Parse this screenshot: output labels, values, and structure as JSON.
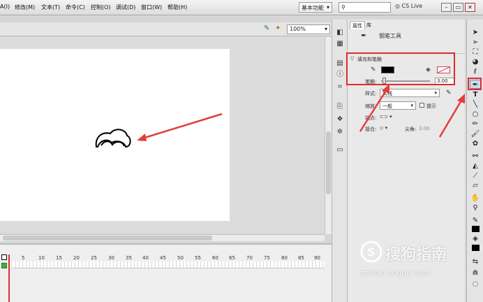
{
  "menubar": {
    "items": [
      "A(I)",
      "修改(M)",
      "文本(T)",
      "命令(C)",
      "控制(O)",
      "调试(D)",
      "窗口(W)",
      "帮助(H)"
    ],
    "workspace": "基本功能",
    "cs_live": "CS Live"
  },
  "document": {
    "zoom": "100%"
  },
  "timeline": {
    "frame_numbers": [
      "5",
      "10",
      "15",
      "20",
      "25",
      "30",
      "35",
      "40",
      "45",
      "50",
      "55",
      "60",
      "65",
      "70",
      "75",
      "80",
      "85",
      "90"
    ]
  },
  "properties": {
    "tab_properties": "属性",
    "tab_library": "库",
    "tool_name": "钢笔工具",
    "section_title": "填充和笔触",
    "stroke_label": "笔触:",
    "stroke_value": "3.00",
    "style_label": "样式:",
    "style_value": "实线",
    "scale_label": "缩放:",
    "scale_value": "一般",
    "hint_label": "提示",
    "cap_label": "端点:",
    "join_label": "接合:",
    "miter_label": "尖角:",
    "miter_value": "3.00",
    "colors": {
      "stroke": "#000000",
      "fill": "none"
    }
  },
  "watermark": {
    "brand": "搜狗指南",
    "url": "zhinan.sogou.com"
  }
}
